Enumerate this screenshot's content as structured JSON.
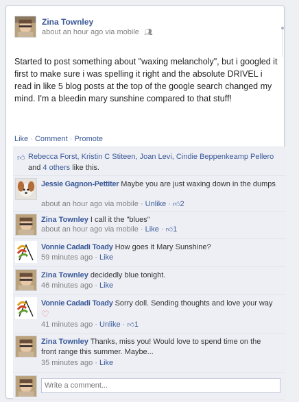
{
  "post": {
    "author": "Zina Townley",
    "meta": "about an hour ago via mobile",
    "text": "Started to post something about \"waxing melancholy\", but i googled it first to make sure i was spelling it right and the absolute DRIVEL i read in like 5 blog posts at the top of the google search changed my mind. I'm a bleedin mary sunshine compared to that stuff!"
  },
  "actions": {
    "like": "Like",
    "comment": "Comment",
    "promote": "Promote",
    "separator": "·"
  },
  "likes": {
    "names": "Rebecca Forst, Kristin C Stiteen, Joan Levi, Cindie Beppenkeamp Pellero",
    "conjunction": "and",
    "others": "4 others",
    "suffix": "like this."
  },
  "comments": [
    {
      "author": "Jessie Gagnon-Pettiter",
      "text": "Maybe you are just waxing down in the dumps",
      "time": "about an hour ago via mobile",
      "action": "Unlike",
      "likes": "2",
      "avatar": "dog"
    },
    {
      "author": "Zina Townley",
      "text": "I call it the \"blues\"",
      "time": "about an hour ago via mobile",
      "action": "Like",
      "likes": "1",
      "avatar": "zina"
    },
    {
      "author": "Vonnie Cadadi Toady",
      "text": "How goes it Mary Sunshine?",
      "time": "59 minutes ago",
      "action": "Like",
      "likes": "",
      "avatar": "flower"
    },
    {
      "author": "Zina Townley",
      "text": "decidedly blue tonight.",
      "time": "46 minutes ago",
      "action": "Like",
      "likes": "",
      "avatar": "zina"
    },
    {
      "author": "Vonnie Cadadi Toady",
      "text": "Sorry doll. Sending thoughts and love your way",
      "time": "41 minutes ago",
      "action": "Unlike",
      "likes": "1",
      "avatar": "flower"
    },
    {
      "author": "Zina Townley",
      "text": "Thanks, miss you! Would love to spend time on the front range this summer. Maybe...",
      "time": "35 minutes ago",
      "action": "Like",
      "likes": "",
      "avatar": "zina"
    }
  ],
  "write": {
    "placeholder": "Write a comment..."
  },
  "icons": {
    "audience": "people-icon",
    "like_thumb": "thumbs-up-icon",
    "heart": "heart-emoticon-icon"
  },
  "colors": {
    "link": "#3b5998",
    "ufi_background": "#edeff4",
    "meta_text": "#808080"
  }
}
